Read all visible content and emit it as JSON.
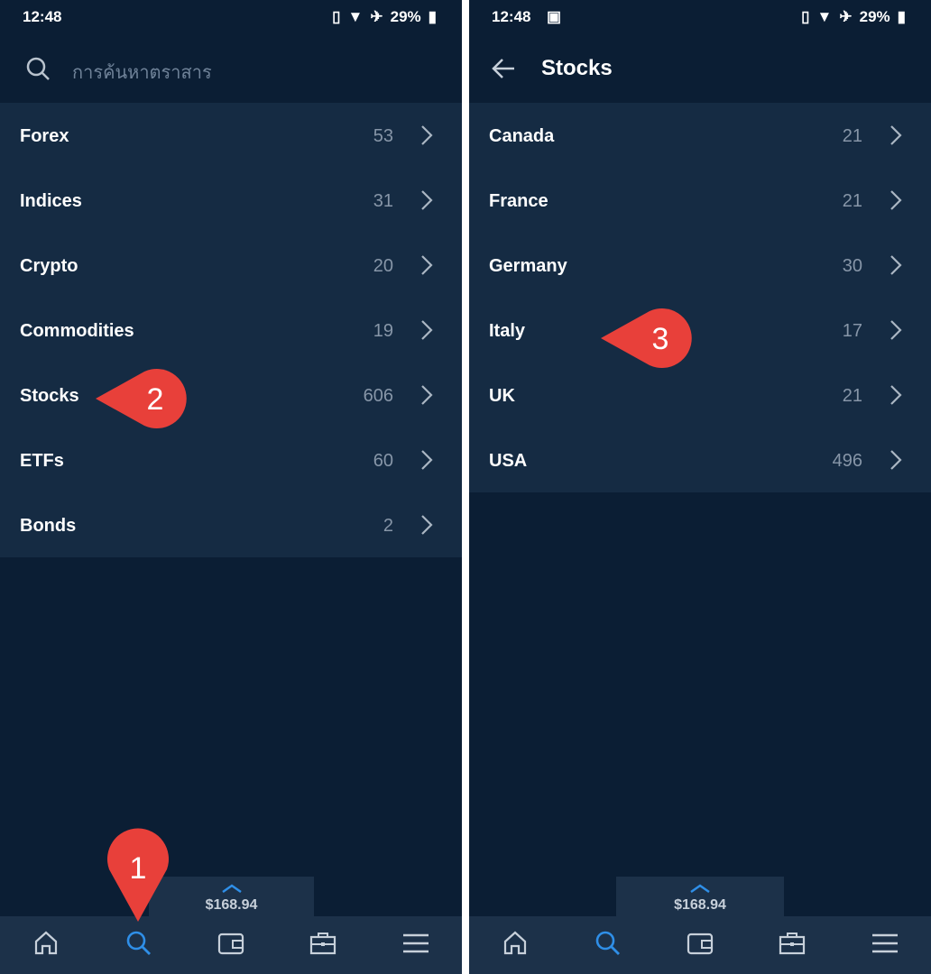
{
  "status": {
    "time": "12:48",
    "battery": "29%"
  },
  "left": {
    "search_placeholder": "การค้นหาตราสาร",
    "items": [
      {
        "label": "Forex",
        "count": "53"
      },
      {
        "label": "Indices",
        "count": "31"
      },
      {
        "label": "Crypto",
        "count": "20"
      },
      {
        "label": "Commodities",
        "count": "19"
      },
      {
        "label": "Stocks",
        "count": "606"
      },
      {
        "label": "ETFs",
        "count": "60"
      },
      {
        "label": "Bonds",
        "count": "2"
      }
    ]
  },
  "right": {
    "title": "Stocks",
    "items": [
      {
        "label": "Canada",
        "count": "21"
      },
      {
        "label": "France",
        "count": "21"
      },
      {
        "label": "Germany",
        "count": "30"
      },
      {
        "label": "Italy",
        "count": "17"
      },
      {
        "label": "UK",
        "count": "21"
      },
      {
        "label": "USA",
        "count": "496"
      }
    ]
  },
  "balance": "$168.94",
  "nav": [
    "home-icon",
    "search-icon",
    "wallet-icon",
    "briefcase-icon",
    "menu-icon"
  ],
  "colors": {
    "accent": "#2f8fe8",
    "marker": "#e8403a",
    "background": "#0b1e34",
    "list": "#152b43",
    "nav": "#1c3149"
  },
  "markers": {
    "m1": "1",
    "m2": "2",
    "m3": "3"
  }
}
